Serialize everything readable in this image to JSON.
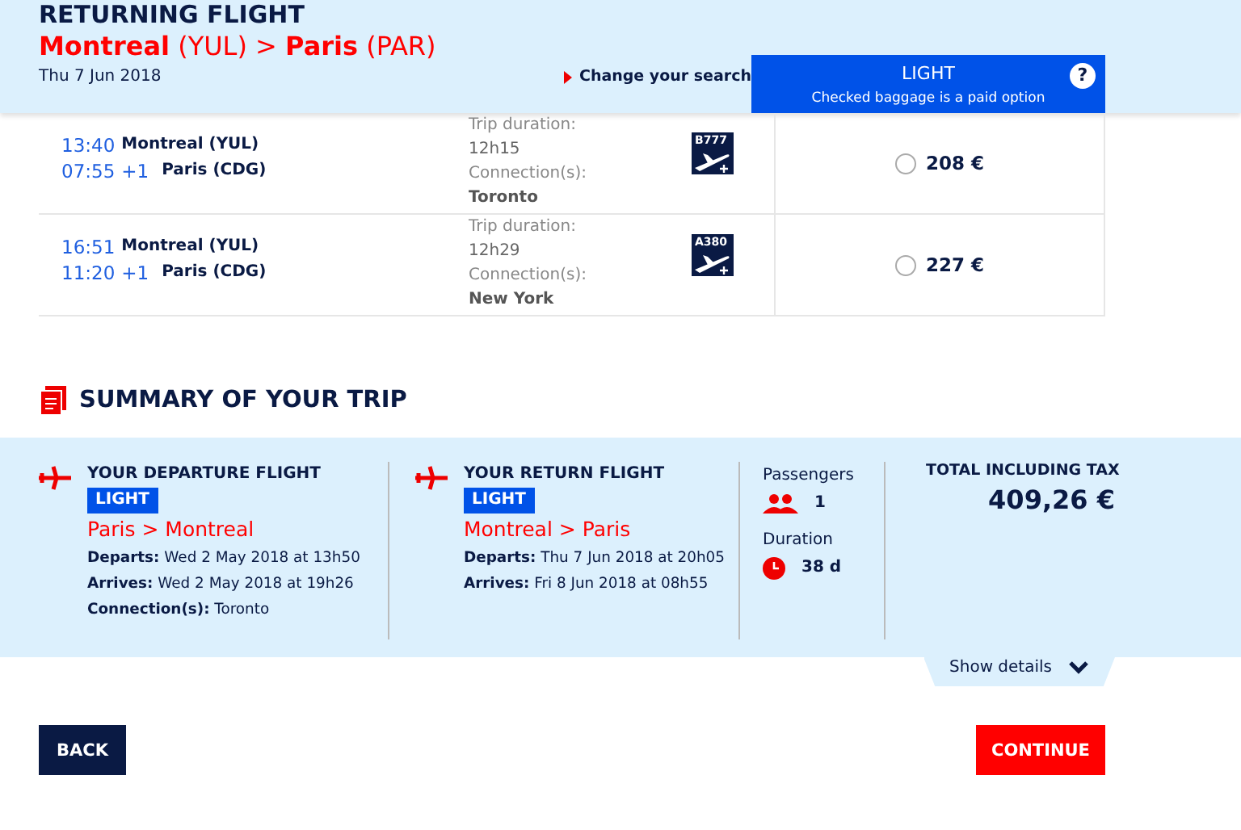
{
  "header": {
    "title": "RETURNING FLIGHT",
    "route": {
      "origin": "Montreal",
      "origin_code": "(YUL)",
      "separator": ">",
      "destination": "Paris",
      "destination_code": "(PAR)"
    },
    "date": "Thu 7 Jun 2018",
    "change_link": "Change your search"
  },
  "fare": {
    "name": "LIGHT",
    "note": "Checked baggage is a paid option",
    "help": "?"
  },
  "flights": [
    {
      "dep_time": "13:40",
      "dep_place": "Montreal (YUL)",
      "arr_time": "07:55",
      "day_offset": "+1",
      "arr_place": "Paris (CDG)",
      "duration_label": "Trip duration:",
      "duration": "12h15",
      "connection_label": "Connection(s):",
      "connection": "Toronto",
      "aircraft": "B777",
      "price": "208 €",
      "selected": false
    },
    {
      "dep_time": "16:51",
      "dep_place": "Montreal (YUL)",
      "arr_time": "11:20",
      "day_offset": "+1",
      "arr_place": "Paris (CDG)",
      "duration_label": "Trip duration:",
      "duration": "12h29",
      "connection_label": "Connection(s):",
      "connection": "New York",
      "aircraft": "A380",
      "price": "227 €",
      "selected": false
    }
  ],
  "summary": {
    "title": "SUMMARY OF YOUR TRIP",
    "legs": [
      {
        "heading": "YOUR DEPARTURE FLIGHT",
        "fare": "LIGHT",
        "route": "Paris > Montreal",
        "lines": [
          "**Departs:** Wed 2 May 2018 at 13h50",
          "**Arrives:** Wed 2 May 2018 at 19h26",
          "**Connection(s):** Toronto"
        ]
      },
      {
        "heading": "YOUR RETURN FLIGHT",
        "fare": "LIGHT",
        "route": "Montreal > Paris",
        "lines": [
          "**Departs:** Thu 7 Jun 2018 at 20h05",
          "**Arrives:** Fri 8 Jun 2018 at 08h55"
        ]
      }
    ],
    "passengers_label": "Passengers",
    "passengers": "1",
    "duration_label": "Duration",
    "duration": "38 d",
    "total_label": "TOTAL INCLUDING TAX",
    "total": "409,26 €",
    "show_details": "Show details"
  },
  "buttons": {
    "back": "BACK",
    "continue": "CONTINUE"
  }
}
